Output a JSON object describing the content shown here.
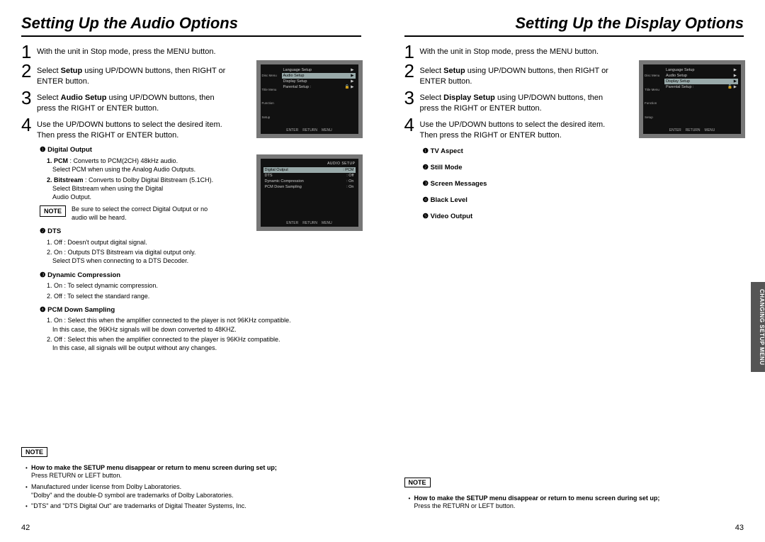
{
  "left": {
    "title": "Setting Up the Audio Options",
    "steps": [
      "With the unit in Stop mode, press the MENU button.",
      "Select <b>Setup</b> using UP/DOWN buttons, then RIGHT or ENTER button.",
      "Select <b>Audio Setup</b> using UP/DOWN buttons, then press the RIGHT or ENTER button.",
      "Use the UP/DOWN buttons to select the desired item. Then press the RIGHT or ENTER button."
    ],
    "menu1": {
      "side": [
        "Disc Menu",
        "Title Menu",
        "Function",
        "Setup"
      ],
      "rows": [
        {
          "l": "Language Setup",
          "r": "▶"
        },
        {
          "l": "Audio Setup",
          "r": "▶",
          "hl": true
        },
        {
          "l": "Display Setup",
          "r": "▶"
        },
        {
          "l": "Parental Setup :",
          "r": "🔓  ▶"
        }
      ],
      "footer": [
        "ENTER",
        "RETURN",
        "MENU"
      ]
    },
    "menu2": {
      "title": "AUDIO SETUP",
      "rows": [
        {
          "l": "Digital Output",
          "r": ": PCM",
          "hl": true
        },
        {
          "l": "DTS",
          "r": ": Off"
        },
        {
          "l": "Dynamic Compression",
          "r": ": On"
        },
        {
          "l": "PCM Down Sampling",
          "r": ": On"
        }
      ],
      "footer": [
        "ENTER",
        "RETURN",
        "MENU"
      ]
    },
    "opt1": {
      "head": "❶ Digital Output",
      "i1b": "1. PCM",
      "i1": " : Converts to PCM(2CH) 48kHz audio.",
      "i1s": "Select PCM when using the Analog Audio Outputs.",
      "i2b": "2. Bitstream",
      "i2": " : Converts to Dolby Digital Bitstream (5.1CH).",
      "i2s1": "Select Bitstream when using the Digital",
      "i2s2": "Audio Output.",
      "note_label": "NOTE",
      "note": "Be sure to select the correct Digital Output or no audio will be heard."
    },
    "opt2": {
      "head": "❷ DTS",
      "l1": "1. Off : Doesn't output digital signal.",
      "l2": "2. On : Outputs DTS Bitstream via digital output only.",
      "l2s": "Select DTS when connecting to a DTS Decoder."
    },
    "opt3": {
      "head": "❸ Dynamic Compression",
      "l1": "1. On : To select dynamic compression.",
      "l2": "2. Off : To select the standard range."
    },
    "opt4": {
      "head": "❹ PCM Down Sampling",
      "l1": "1. On : Select this when the amplifier connected to the player is not 96KHz compatible.",
      "l1s": "In this case, the 96KHz signals will be down converted to 48KHZ.",
      "l2": "2. Off : Select this when the amplifier connected to the player is 96KHz compatible.",
      "l2s": "In this case, all signals will be output without any changes."
    },
    "bottom": {
      "label": "NOTE",
      "b1q": "How to make the SETUP menu disappear or return to menu screen during set up;",
      "b1a": "Press RETURN or LEFT button.",
      "b2a": "Manufactured under license from Dolby Laboratories.",
      "b2b": "\"Dolby\" and the double-D symbol are trademarks of Dolby Laboratories.",
      "b3": "\"DTS\" and \"DTS Digital Out\" are trademarks of Digital Theater Systems, Inc."
    },
    "page": "42"
  },
  "right": {
    "title": "Setting Up the Display Options",
    "steps": [
      "With the unit in Stop mode, press the MENU button.",
      "Select <b>Setup</b> using UP/DOWN buttons, then RIGHT or ENTER button.",
      "Select <b>Display Setup</b> using UP/DOWN buttons, then press the RIGHT or ENTER button.",
      "Use the UP/DOWN buttons to select the desired item. Then press the RIGHT or ENTER button."
    ],
    "menu1": {
      "side": [
        "Disc Menu",
        "Title Menu",
        "Function",
        "Setup"
      ],
      "rows": [
        {
          "l": "Language Setup",
          "r": "▶"
        },
        {
          "l": "Audio Setup",
          "r": "▶"
        },
        {
          "l": "Display Setup",
          "r": "▶",
          "hl": true
        },
        {
          "l": "Parental Setup :",
          "r": "🔓  ▶"
        }
      ],
      "footer": [
        "ENTER",
        "RETURN",
        "MENU"
      ]
    },
    "list": [
      "❶ TV Aspect",
      "❷ Still Mode",
      "❸ Screen Messages",
      "❹ Black Level",
      "❺ Video Output"
    ],
    "sidetab": "CHANGING SETUP MENU",
    "bottom": {
      "label": "NOTE",
      "b1q": "How to make the SETUP menu disappear or return to menu screen during set up;",
      "b1a": "Press the RETURN or LEFT button."
    },
    "page": "43"
  }
}
